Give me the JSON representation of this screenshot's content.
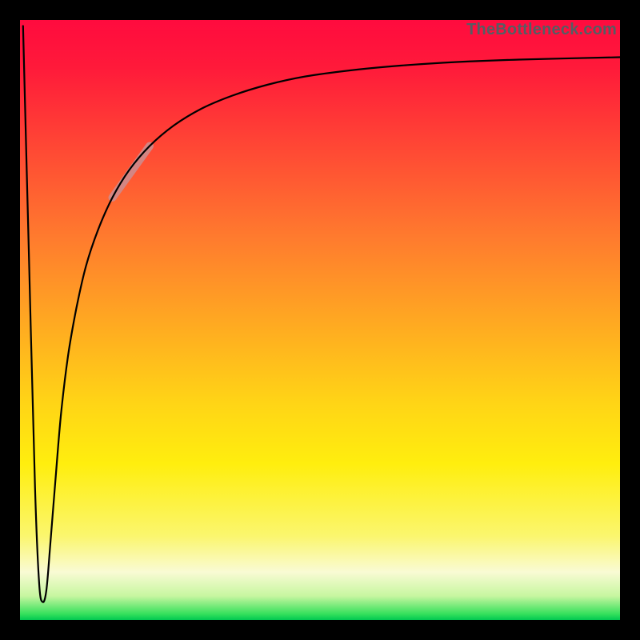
{
  "watermark": "TheBottleneck.com",
  "colors": {
    "frame": "#000000",
    "curve": "#000000",
    "highlight": "#cf8a8a",
    "gradient_top": "#ff0b3e",
    "gradient_bottom": "#00c851"
  },
  "chart_data": {
    "type": "line",
    "title": "",
    "xlabel": "",
    "ylabel": "",
    "xlim": [
      0,
      100
    ],
    "ylim": [
      0,
      100
    ],
    "grid": false,
    "legend": false,
    "series": [
      {
        "name": "main-curve",
        "x": [
          0.5,
          1.5,
          2.5,
          3.2,
          3.8,
          4.4,
          5.0,
          5.8,
          6.8,
          8.0,
          9.4,
          11.0,
          13.0,
          15.4,
          18.2,
          21.6,
          25.6,
          30.2,
          35.4,
          41.2,
          47.6,
          55.0,
          63.4,
          72.8,
          83.2,
          100.0
        ],
        "y": [
          99.0,
          60.0,
          22.0,
          6.0,
          3.0,
          5.0,
          12.0,
          22.0,
          34.0,
          44.0,
          52.0,
          59.0,
          65.0,
          70.4,
          75.0,
          79.0,
          82.4,
          85.2,
          87.4,
          89.2,
          90.6,
          91.6,
          92.4,
          93.0,
          93.4,
          93.8
        ]
      },
      {
        "name": "highlight-segment",
        "x": [
          15.4,
          21.6
        ],
        "y": [
          70.4,
          79.0
        ]
      }
    ],
    "annotations": []
  }
}
